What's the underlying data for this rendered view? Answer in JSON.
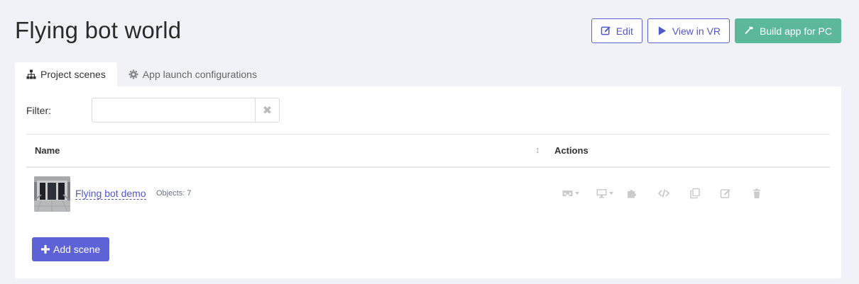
{
  "page": {
    "title": "Flying bot world"
  },
  "header_actions": {
    "edit_label": "Edit",
    "view_vr_label": "View in VR",
    "build_label": "Build app for PC"
  },
  "tabs": [
    {
      "label": "Project scenes",
      "icon": "sitemap-icon",
      "active": true
    },
    {
      "label": "App launch configurations",
      "icon": "gear-icon",
      "active": false
    }
  ],
  "filter": {
    "label": "Filter:",
    "value": "",
    "clear_icon": "✖"
  },
  "table": {
    "headers": {
      "name": "Name",
      "actions": "Actions"
    },
    "sort_icon": "↕",
    "rows": [
      {
        "name": "Flying bot demo",
        "objects": "Objects: 7",
        "actions": [
          "vr-headset-icon",
          "desktop-icon",
          "puzzle-icon",
          "code-icon",
          "copy-icon",
          "edit-icon",
          "trash-icon"
        ]
      }
    ]
  },
  "add_scene": {
    "label": "Add scene",
    "icon": "plus-icon"
  },
  "colors": {
    "accent": "#5d63d6",
    "success": "#5cb89b",
    "background": "#f1f2f8",
    "action_icon": "#cbcbcb"
  }
}
